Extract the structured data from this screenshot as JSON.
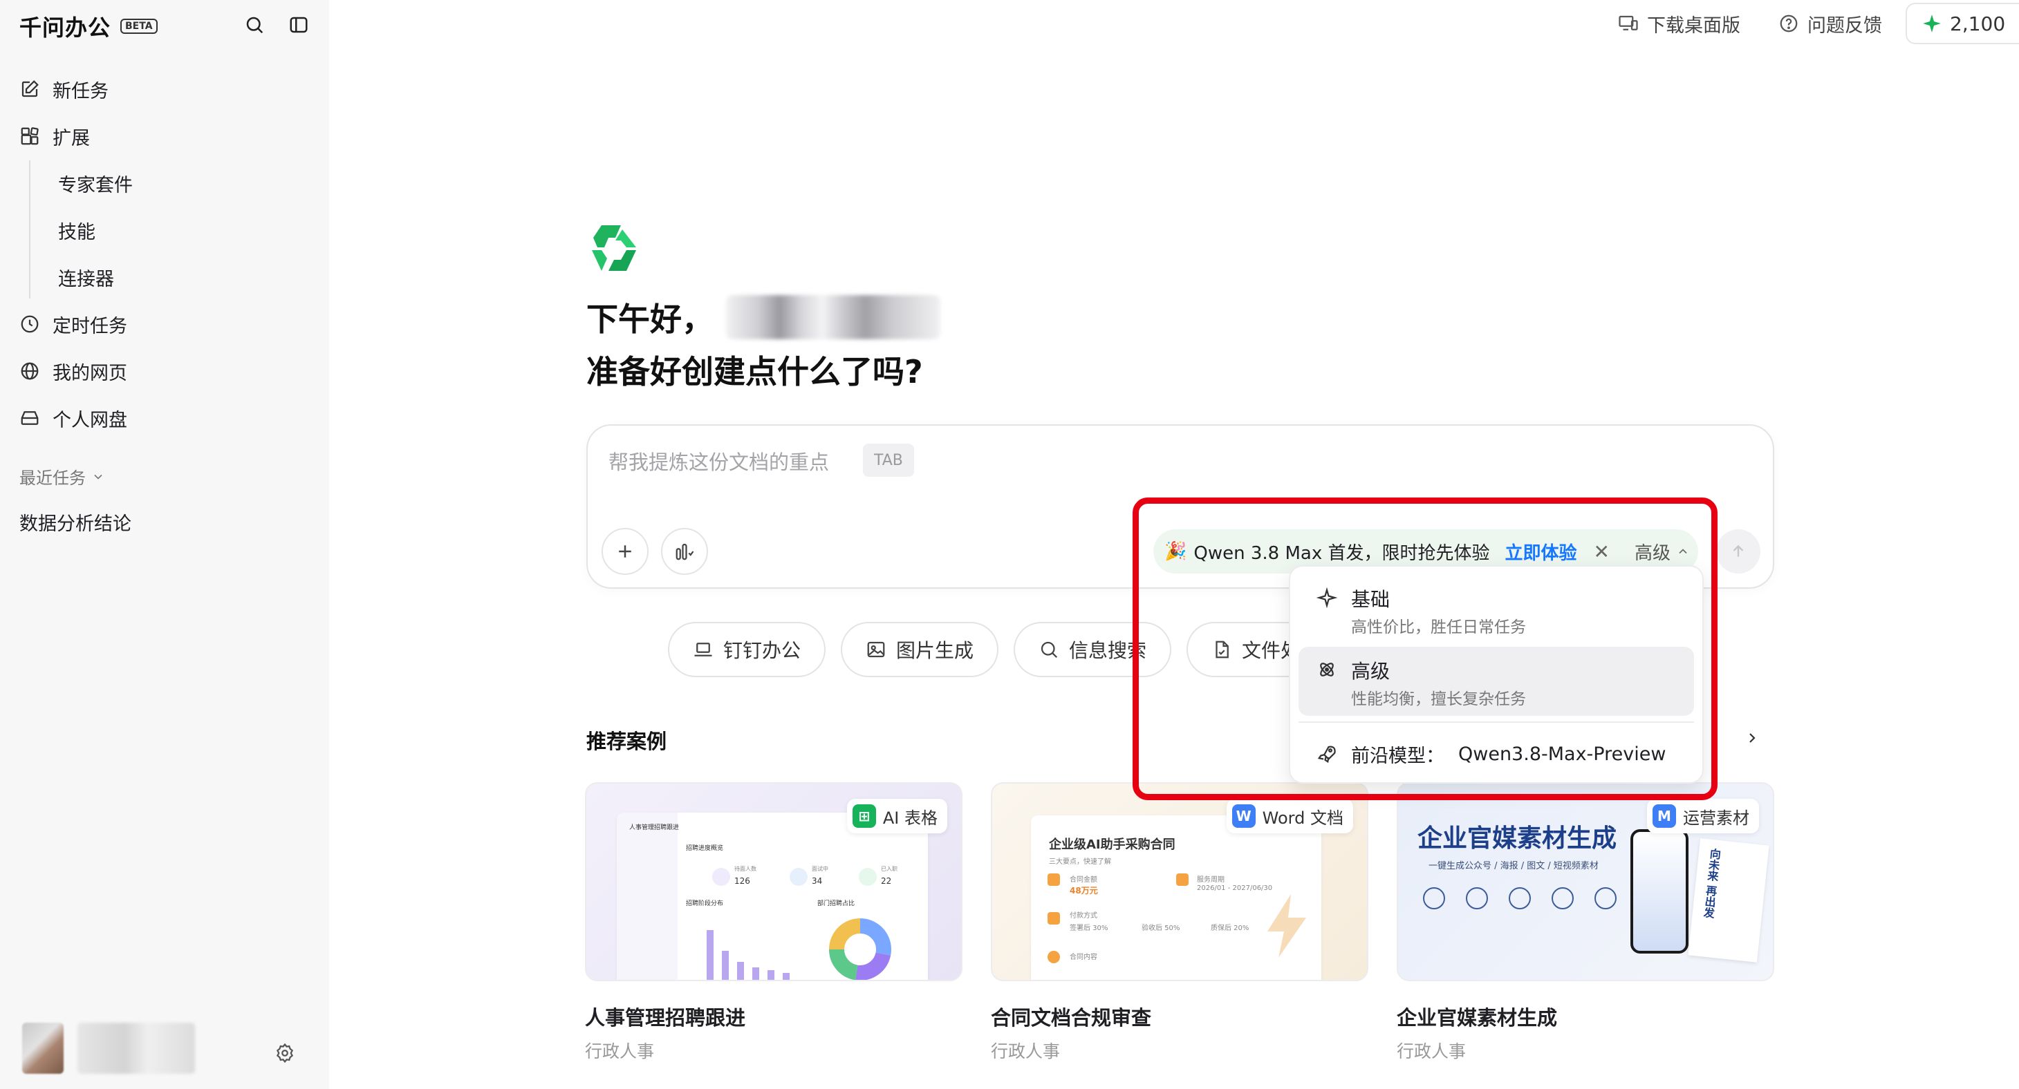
{
  "brand": {
    "name": "千问办公",
    "badge": "BETA"
  },
  "sidebar": {
    "items": [
      {
        "label": "新任务",
        "icon": "edit-icon"
      },
      {
        "label": "扩展",
        "icon": "apps-icon"
      },
      {
        "label": "定时任务",
        "icon": "clock-icon"
      },
      {
        "label": "我的网页",
        "icon": "globe-icon"
      },
      {
        "label": "个人网盘",
        "icon": "drive-icon"
      }
    ],
    "sub_items": [
      {
        "label": "专家套件"
      },
      {
        "label": "技能"
      },
      {
        "label": "连接器"
      }
    ],
    "recent_header": "最近任务",
    "recent_items": [
      {
        "label": "数据分析结论"
      }
    ]
  },
  "topbar": {
    "download": "下载桌面版",
    "feedback": "问题反馈",
    "credits": "2,100"
  },
  "greeting": {
    "line1": "下午好，",
    "line2": "准备好创建点什么了吗?"
  },
  "input": {
    "placeholder": "帮我提炼这份文档的重点",
    "tab_hint": "TAB"
  },
  "promo": {
    "emoji": "🎉",
    "text": "Qwen 3.8 Max 首发，限时抢先体验",
    "cta": "立即体验",
    "level": "高级"
  },
  "model_menu": {
    "options": [
      {
        "title": "基础",
        "desc": "高性价比，胜任日常任务",
        "icon": "sparkle-icon"
      },
      {
        "title": "高级",
        "desc": "性能均衡，擅长复杂任务",
        "icon": "atom-icon"
      }
    ],
    "frontier_label": "前沿模型：",
    "frontier_value": "Qwen3.8-Max-Preview"
  },
  "chips": [
    {
      "label": "钉钉办公",
      "icon": "laptop-icon"
    },
    {
      "label": "图片生成",
      "icon": "image-icon"
    },
    {
      "label": "信息搜索",
      "icon": "search-icon"
    },
    {
      "label": "文件处理",
      "icon": "file-icon"
    }
  ],
  "recommend": {
    "title": "推荐案例",
    "cards": [
      {
        "title": "人事管理招聘跟进",
        "category": "行政人事",
        "badge": "AI 表格"
      },
      {
        "title": "合同文档合规审查",
        "category": "行政人事",
        "badge": "Word 文档"
      },
      {
        "title": "企业官媒素材生成",
        "category": "行政人事",
        "badge": "运营素材"
      }
    ]
  },
  "card_previews": {
    "hr": {
      "title": "人事管理招聘跟进",
      "section": "招聘进度概览",
      "stats": [
        {
          "label": "待面人数",
          "value": "126"
        },
        {
          "label": "面试中",
          "value": "34"
        },
        {
          "label": "已入职",
          "value": "22"
        }
      ],
      "chart_left": "招聘阶段分布",
      "chart_right": "部门招聘占比"
    },
    "contract": {
      "title": "企业级AI助手采购合同",
      "subtitle": "三大要点，快速了解",
      "fields": [
        "合同金额",
        "48万元",
        "服务周期",
        "2026/01 - 2027/06/30",
        "付款方式",
        "签署后 30%",
        "验收后 50%",
        "质保后 20%",
        "合同内容"
      ]
    },
    "media": {
      "title": "企业官媒素材生成",
      "subtitle": "一键生成公众号 / 海报 / 图文 / 短视频素材",
      "phone_text": "向未来 再出发"
    }
  },
  "colors": {
    "accent_green": "#16b35a",
    "link_blue": "#1677ff",
    "highlight_red": "#e60012"
  }
}
